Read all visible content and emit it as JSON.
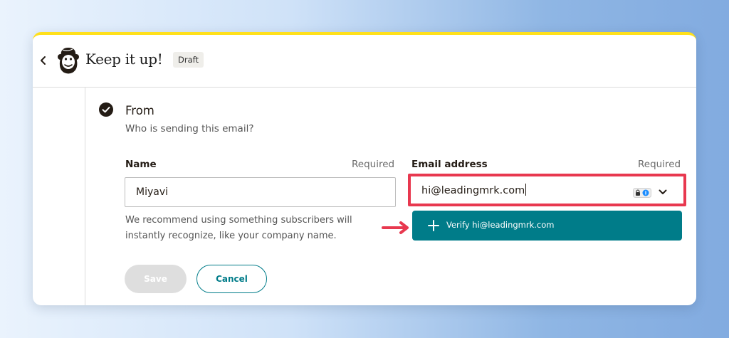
{
  "header": {
    "title": "Keep it up!",
    "badge": "Draft"
  },
  "section": {
    "title": "From",
    "subtitle": "Who is sending this email?"
  },
  "name_field": {
    "label": "Name",
    "required": "Required",
    "value": "Miyavi",
    "hint": "We recommend using something subscribers will instantly recognize, like your company name."
  },
  "email_field": {
    "label": "Email address",
    "required": "Required",
    "value": "hi@leadingmrk.com",
    "dropdown_option": "Verify hi@leadingmrk.com"
  },
  "actions": {
    "save": "Save",
    "cancel": "Cancel"
  },
  "colors": {
    "accent_yellow": "#ffe01b",
    "teal": "#007c89",
    "highlight_red": "#e8384f"
  }
}
